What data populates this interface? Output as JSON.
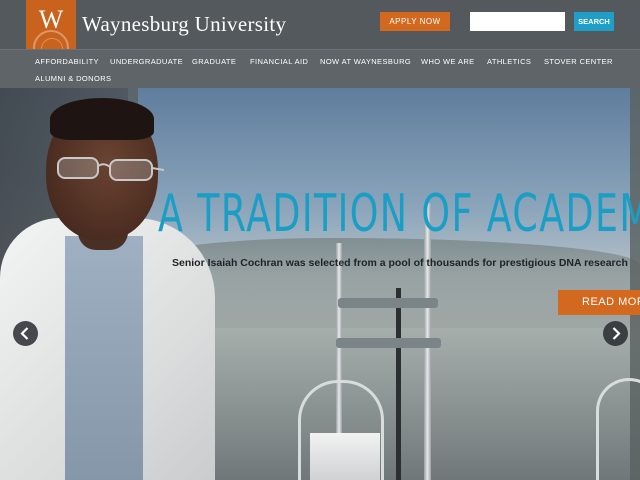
{
  "header": {
    "logo_letter": "W",
    "logo_text": "Waynesburg University",
    "apply_label": "APPLY NOW",
    "search_placeholder": "",
    "search_label": "SEARCH"
  },
  "nav": {
    "items": [
      {
        "label": "AFFORDABILITY"
      },
      {
        "label": "UNDERGRADUATE"
      },
      {
        "label": "GRADUATE"
      },
      {
        "label": "FINANCIAL AID"
      },
      {
        "label": "NOW AT WAYNESBURG"
      },
      {
        "label": "WHO WE ARE"
      },
      {
        "label": "ATHLETICS"
      },
      {
        "label": "STOVER CENTER"
      },
      {
        "label": "ALUMNI & DONORS"
      }
    ]
  },
  "hero": {
    "title": "A TRADITION OF ACADEMIC",
    "subtitle": "Senior Isaiah Cochran was selected from a pool of thousands for prestigious DNA research",
    "cta_label": "READ MORE",
    "prev_icon": "chevron-left-icon",
    "next_icon": "chevron-right-icon"
  },
  "colors": {
    "brand_orange": "#d2691e",
    "accent_blue": "#1b9ec6",
    "header_gray": "#54595e",
    "nav_gray": "#5f6468"
  }
}
